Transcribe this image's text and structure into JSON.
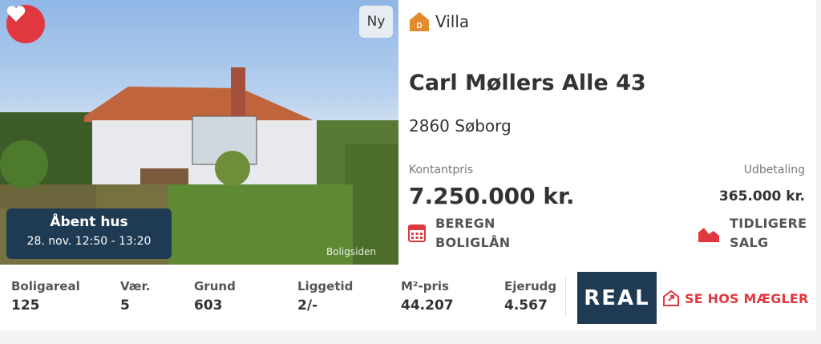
{
  "listing": {
    "type": "Villa",
    "energy_label": "D",
    "new_badge": "Ny",
    "address": "Carl Møllers Alle 43",
    "zip_city": "2860 Søborg",
    "cash_price_label": "Kontantpris",
    "cash_price": "7.250.000 kr.",
    "down_payment_label": "Udbetaling",
    "down_payment": "365.000 kr.",
    "open_house": {
      "title": "Åbent hus",
      "time": "28. nov. 12:50 - 13:20"
    },
    "watermark": "Boligsiden"
  },
  "actions": {
    "calc_line1": "BEREGN",
    "calc_line2": "BOLIGLÅN",
    "history_line1": "TIDLIGERE",
    "history_line2": "SALG",
    "agent": "SE HOS MÆGLER"
  },
  "stats": [
    {
      "label": "Boligareal",
      "value": "125"
    },
    {
      "label": "Vær.",
      "value": "5"
    },
    {
      "label": "Grund",
      "value": "603"
    },
    {
      "label": "Liggetid",
      "value": "2/-"
    },
    {
      "label": "M²-pris",
      "value": "44.207"
    },
    {
      "label": "Ejerudg",
      "value": "4.567"
    }
  ],
  "agent_logo": "REAL",
  "colors": {
    "accent": "#e0383e",
    "navy": "#1f3a53",
    "energy": "#e38a2e"
  },
  "icons": [
    "heart-icon",
    "house-energy-icon",
    "calculator-icon",
    "chart-icon",
    "house-link-icon"
  ]
}
